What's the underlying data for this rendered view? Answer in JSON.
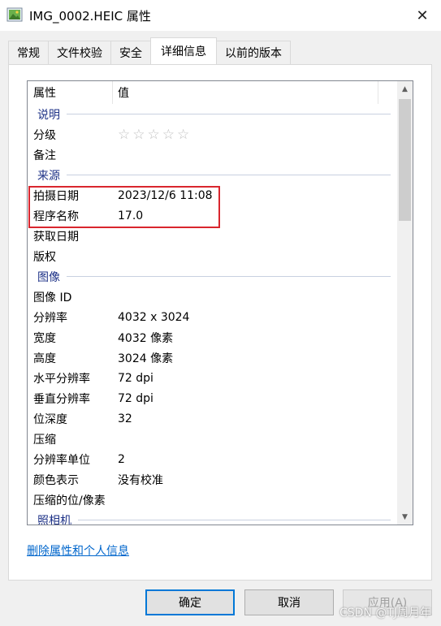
{
  "window": {
    "title": "IMG_0002.HEIC 属性",
    "close_label": "✕"
  },
  "tabs": [
    {
      "label": "常规"
    },
    {
      "label": "文件校验"
    },
    {
      "label": "安全"
    },
    {
      "label": "详细信息",
      "active": true
    },
    {
      "label": "以前的版本"
    }
  ],
  "list": {
    "header_property": "属性",
    "header_value": "值",
    "groups": {
      "description": "说明",
      "origin": "来源",
      "image": "图像",
      "camera": "照相机"
    },
    "rows": {
      "rating": {
        "key": "分级",
        "value": "☆☆☆☆☆"
      },
      "comments": {
        "key": "备注",
        "value": ""
      },
      "date_taken": {
        "key": "拍摄日期",
        "value": "2023/12/6 11:08"
      },
      "program_name": {
        "key": "程序名称",
        "value": "17.0"
      },
      "date_acquired": {
        "key": "获取日期",
        "value": ""
      },
      "copyright": {
        "key": "版权",
        "value": ""
      },
      "image_id": {
        "key": "图像 ID",
        "value": ""
      },
      "dimensions": {
        "key": "分辨率",
        "value": "4032 x 3024"
      },
      "width": {
        "key": "宽度",
        "value": "4032 像素"
      },
      "height": {
        "key": "高度",
        "value": "3024 像素"
      },
      "h_res": {
        "key": "水平分辨率",
        "value": "72 dpi"
      },
      "v_res": {
        "key": "垂直分辨率",
        "value": "72 dpi"
      },
      "bit_depth": {
        "key": "位深度",
        "value": "32"
      },
      "compression": {
        "key": "压缩",
        "value": ""
      },
      "res_unit": {
        "key": "分辨率单位",
        "value": "2"
      },
      "color_rep": {
        "key": "颜色表示",
        "value": "没有校准"
      },
      "compressed_bits": {
        "key": "压缩的位/像素",
        "value": ""
      }
    }
  },
  "remove_link": "删除属性和个人信息",
  "buttons": {
    "ok": "确定",
    "cancel": "取消",
    "apply": "应用(A)"
  },
  "watermark": "CSDN @TJ周月年",
  "colors": {
    "highlight_border": "#d9262e",
    "link": "#0066cc",
    "group_header": "#1e3287",
    "ok_border": "#0078d7"
  }
}
